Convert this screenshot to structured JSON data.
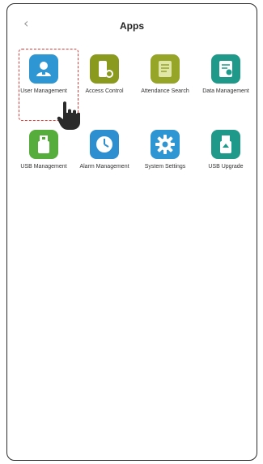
{
  "header": {
    "back_icon": "chevron-left-icon",
    "title": "Apps"
  },
  "apps": [
    {
      "id": "user-management",
      "label": "User Management",
      "icon": "user-icon",
      "color": "#2e96d2"
    },
    {
      "id": "access-control",
      "label": "Access Control",
      "icon": "lock-icon",
      "color": "#8a9a1f"
    },
    {
      "id": "attendance-search",
      "label": "Attendance Search",
      "icon": "document-icon",
      "color": "#96a428"
    },
    {
      "id": "data-management",
      "label": "Data Management",
      "icon": "database-icon",
      "color": "#1f9a8a"
    },
    {
      "id": "usb-management",
      "label": "USB Management",
      "icon": "usb-icon",
      "color": "#56ad3c"
    },
    {
      "id": "alarm-management",
      "label": "Alarm Management",
      "icon": "clock-icon",
      "color": "#2e8fd0"
    },
    {
      "id": "system-settings",
      "label": "System Settings",
      "icon": "gear-icon",
      "color": "#2e96d2"
    },
    {
      "id": "usb-upgrade",
      "label": "USB Upgrade",
      "icon": "usb-upgrade-icon",
      "color": "#1f9a8a"
    }
  ],
  "selection": {
    "selected_app": "user-management",
    "cursor_icon": "hand-pointer-icon"
  }
}
